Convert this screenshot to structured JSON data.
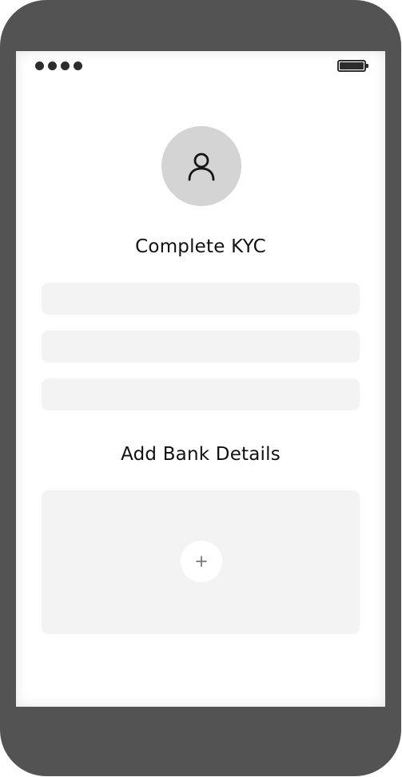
{
  "status_bar": {
    "signal_dots": 4,
    "signal_icon": "signal-dots-icon",
    "battery_icon": "battery-full-icon"
  },
  "profile": {
    "avatar_icon": "user-icon"
  },
  "kyc": {
    "title": "Complete KYC",
    "fields": [
      {
        "value": "",
        "placeholder": ""
      },
      {
        "value": "",
        "placeholder": ""
      },
      {
        "value": "",
        "placeholder": ""
      }
    ]
  },
  "bank": {
    "title": "Add Bank Details",
    "add_icon": "plus-icon"
  },
  "colors": {
    "frame": "#535353",
    "screen": "#ffffff",
    "field_bg": "#f3f3f3",
    "avatar_bg": "#d4d4d4",
    "text": "#111111"
  }
}
